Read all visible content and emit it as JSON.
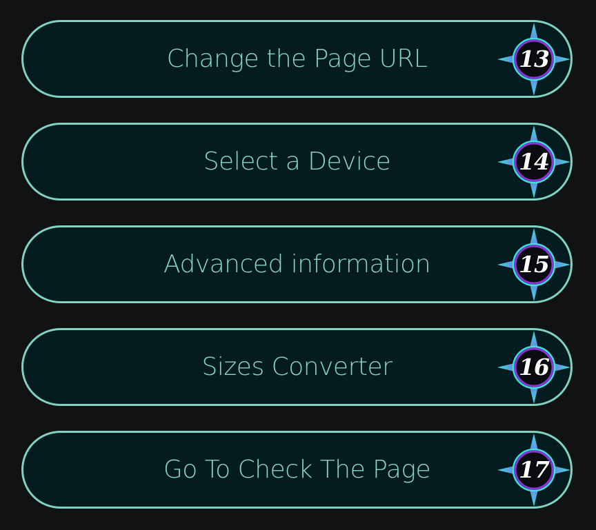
{
  "menu": {
    "items": [
      {
        "label": "Change the Page URL",
        "number": "13"
      },
      {
        "label": "Select a Device",
        "number": "14"
      },
      {
        "label": "Advanced information",
        "number": "15"
      },
      {
        "label": "Sizes Converter",
        "number": "16"
      },
      {
        "label": "Go To Check The Page",
        "number": "17"
      }
    ]
  },
  "colors": {
    "background": "#111213",
    "pill_fill": "#041b1f",
    "pill_border": "#7fd3c0",
    "label_text": "#8cd6c3",
    "badge_purple": "#7a2fd0",
    "badge_cyan": "#3fe0e0",
    "badge_number": "#ffffff"
  }
}
